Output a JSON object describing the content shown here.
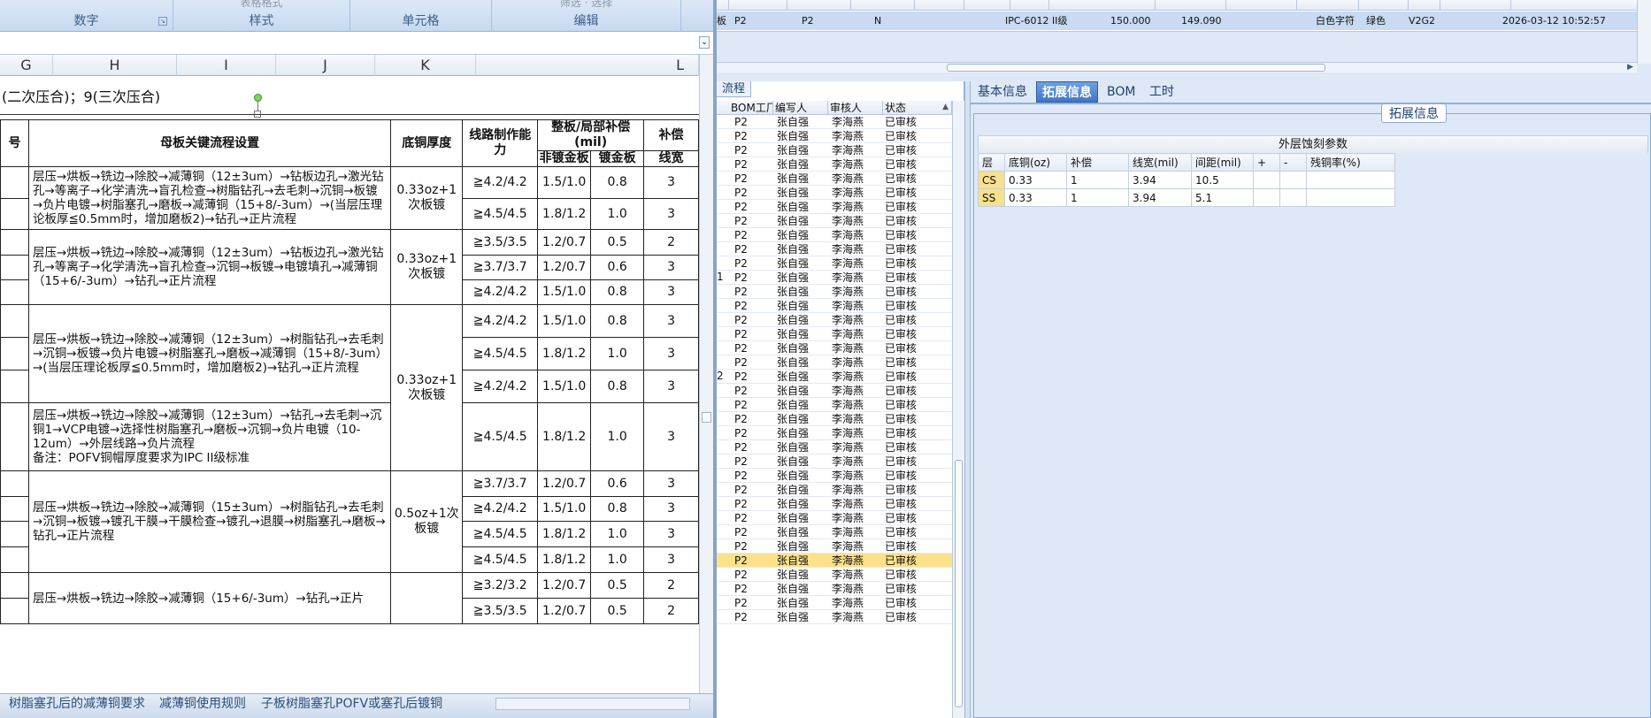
{
  "ribbon": {
    "groups": [
      {
        "top": "",
        "label": "数字"
      },
      {
        "top": "表格格式",
        "label": "样式"
      },
      {
        "top": "",
        "label": "单元格"
      },
      {
        "top": "筛选 · 选择",
        "label": "编辑"
      }
    ]
  },
  "sheet": {
    "col_headers": [
      "G",
      "H",
      "I",
      "J",
      "K",
      "L"
    ],
    "note": "(二次压合)；9(三次压合)",
    "headers": {
      "c0": "号",
      "proc": "母板关键流程设置",
      "cu": "底铜厚度",
      "ability": "线路制作能力",
      "comp": "整板/局部补偿(mil)",
      "comp_a": "非镀金板",
      "comp_b": "镀金板",
      "extra": "补偿",
      "extra2": "线宽"
    },
    "blocks": [
      {
        "proc": "层压→烘板→铣边→除胶→减薄铜（12±3um）→钻板边孔→激光钻孔→等离子→化学清洗→盲孔检查→树脂钻孔→去毛刺→沉铜→板镀→负片电镀→树脂塞孔→磨板→减薄铜（15+8/-3um）→(当层压理论板厚≦0.5mm时，增加磨板2)→钻孔→正片流程",
        "cu": "0.33oz+1次板镀",
        "rows": [
          [
            "≧4.2/4.2",
            "1.5/1.0",
            "0.8",
            "3"
          ],
          [
            "≧4.5/4.5",
            "1.8/1.2",
            "1.0",
            "3"
          ]
        ]
      },
      {
        "proc": "层压→烘板→铣边→除胶→减薄铜（12±3um）→钻板边孔→激光钻孔→等离子→化学清洗→盲孔检查→沉铜→板镀→电镀填孔→减薄铜（15+6/-3um）→钻孔→正片流程",
        "cu": "0.33oz+1次板镀",
        "rows": [
          [
            "≧3.5/3.5",
            "1.2/0.7",
            "0.5",
            "2"
          ],
          [
            "≧3.7/3.7",
            "1.2/0.7",
            "0.6",
            "3"
          ],
          [
            "≧4.2/4.2",
            "1.5/1.0",
            "0.8",
            "3"
          ]
        ]
      },
      {
        "proc": "层压→烘板→铣边→除胶→减薄铜（12±3um）→树脂钻孔→去毛刺→沉铜→板镀→负片电镀→树脂塞孔→磨板→减薄铜（15+8/-3um）→(当层压理论板厚≦0.5mm时，增加磨板2)→钻孔→正片流程",
        "cu": "0.33oz+1次板镀",
        "rows": [
          [
            "≧4.2/4.2",
            "1.5/1.0",
            "0.8",
            "3"
          ],
          [
            "≧4.5/4.5",
            "1.8/1.2",
            "1.0",
            "3"
          ],
          [
            "≧4.2/4.2",
            "1.5/1.0",
            "0.8",
            "3"
          ]
        ]
      },
      {
        "proc": "层压→烘板→铣边→除胶→减薄铜（12±3um）→钻孔→去毛刺→沉铜1→VCP电镀→选择性树脂塞孔→磨板→沉铜→负片电镀（10-12um）→外层线路→负片流程\n备注：POFV铜帽厚度要求为IPC II级标准",
        "cu": "",
        "rows": [
          [
            "≧4.5/4.5",
            "1.8/1.2",
            "1.0",
            "3"
          ]
        ]
      },
      {
        "proc": "层压→烘板→铣边→除胶→减薄铜（15±3um）→树脂钻孔→去毛刺→沉铜→板镀→镀孔干膜→干膜检查→镀孔→退膜→树脂塞孔→磨板→钻孔→正片流程",
        "cu": "0.5oz+1次板镀",
        "rows": [
          [
            "≧3.7/3.7",
            "1.2/0.7",
            "0.6",
            "3"
          ],
          [
            "≧4.2/4.2",
            "1.5/1.0",
            "0.8",
            "3"
          ],
          [
            "≧4.5/4.5",
            "1.8/1.2",
            "1.0",
            "3"
          ],
          [
            "≧4.5/4.5",
            "1.8/1.2",
            "1.0",
            "3"
          ]
        ]
      },
      {
        "proc": "层压→烘板→铣边→除胶→减薄铜（15+6/-3um）→钻孔→正片",
        "cu": "",
        "rows": [
          [
            "≧3.2/3.2",
            "1.2/0.7",
            "0.5",
            "2"
          ],
          [
            "≧3.5/3.5",
            "1.2/0.7",
            "0.5",
            "2"
          ]
        ]
      }
    ],
    "tabs": [
      "树脂塞孔后的减薄铜要求",
      "减薄铜使用规则",
      "子板树脂塞孔POFV或塞孔后镀铜"
    ]
  },
  "topgrid": {
    "cells": [
      "板",
      "P2",
      "P2",
      "N",
      "IPC-6012 II级",
      "150.000",
      "149.090",
      "白色字符",
      "绿色",
      "V2G2",
      "2026-03-12 10:52:57"
    ]
  },
  "flow": {
    "tab": "流程",
    "headers": [
      "BOM工厂",
      "编写人",
      "审核人",
      "状态"
    ],
    "row": {
      "bom": "P2",
      "writer": "张自强",
      "reviewer": "李海燕",
      "status": "已审核"
    },
    "row_count": 36,
    "selected_index": 31,
    "left_marks": [
      "1",
      "2"
    ]
  },
  "detail": {
    "tabs": [
      "基本信息",
      "拓展信息",
      "BOM",
      "工时"
    ],
    "active_tab": 1,
    "group_title": "拓展信息",
    "panel_title": "外层蚀刻参数",
    "columns": [
      "层",
      "底铜(oz)",
      "补偿",
      "线宽(mil)",
      "间距(mil)",
      "+",
      "-",
      "残铜率(%)"
    ],
    "rows": [
      [
        "CS",
        "0.33",
        "1",
        "3.94",
        "10.5",
        "",
        "",
        ""
      ],
      [
        "SS",
        "0.33",
        "1",
        "3.94",
        "5.1",
        "",
        "",
        ""
      ]
    ]
  }
}
